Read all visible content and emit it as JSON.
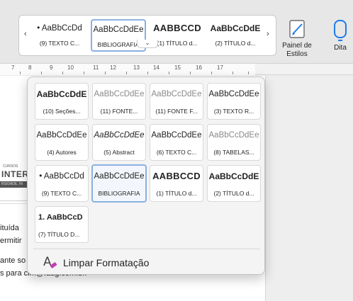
{
  "ribbon": {
    "gallery_styles": [
      {
        "preview": "AaBbCcDd",
        "label": "(9) TEXTO C..."
      },
      {
        "preview": "AaBbCcDdEe",
        "label": "BIBLIOGRAFIA"
      },
      {
        "preview": "AABBCCD",
        "label": "(1) TÍTULO d..."
      },
      {
        "preview": "AaBbCcDdE",
        "label": "(2) TÍTULO d..."
      }
    ],
    "prev_arrow": "‹",
    "next_arrow": "›",
    "caret": "⌄",
    "styles_pane_label_line1": "Painel de",
    "styles_pane_label_line2": "Estilos",
    "dictate_label": "Dita"
  },
  "ruler": {
    "ticks": [
      "7",
      "8",
      "9",
      "10",
      "11",
      "12",
      "13",
      "14",
      "15",
      "16",
      "17"
    ]
  },
  "styles_panel": {
    "styles": [
      {
        "preview": "AaBbCcDdE",
        "label": "(10) Seções..."
      },
      {
        "preview": "AaBbCcDdEe",
        "label": "(11) FONTE..."
      },
      {
        "preview": "AaBbCcDdEe",
        "label": "(11) FONTE F..."
      },
      {
        "preview": "AaBbCcDdEe",
        "label": "(3) TEXTO R..."
      },
      {
        "preview": "AaBbCcDdEe",
        "label": "(4) Autores"
      },
      {
        "preview": "AaBbCcDdEe",
        "label": "(5) Abstract"
      },
      {
        "preview": "AaBbCcDdEe",
        "label": "(6) TEXTO C..."
      },
      {
        "preview": "AaBbCcDdEe",
        "label": "(8) TABELAS..."
      },
      {
        "preview": "AaBbCcDd",
        "label": "(9) TEXTO C..."
      },
      {
        "preview": "AaBbCcDdEe",
        "label": "BIBLIOGRAFIA"
      },
      {
        "preview": "AABBCCD",
        "label": "(1) TÍTULO d..."
      },
      {
        "preview": "AaBbCcDdE",
        "label": "(2) TÍTULO d..."
      },
      {
        "preview": "1.  AaBbCcD",
        "label": "(7) TÍTULO D..."
      }
    ],
    "clear_formatting": "Limpar Formatação"
  },
  "document": {
    "logo_small": "CURSOS",
    "logo_big": "INTERN/",
    "logo_bar": "RSIDADE, IN",
    "lines": [
      "ituída",
      "ermitir",
      "ante so",
      "s para cim@faag.com.br."
    ]
  },
  "colors": {
    "selection_border": "#8ab0e0",
    "accent_blue": "#1e7ce8",
    "eraser_magenta": "#c13fb0"
  }
}
